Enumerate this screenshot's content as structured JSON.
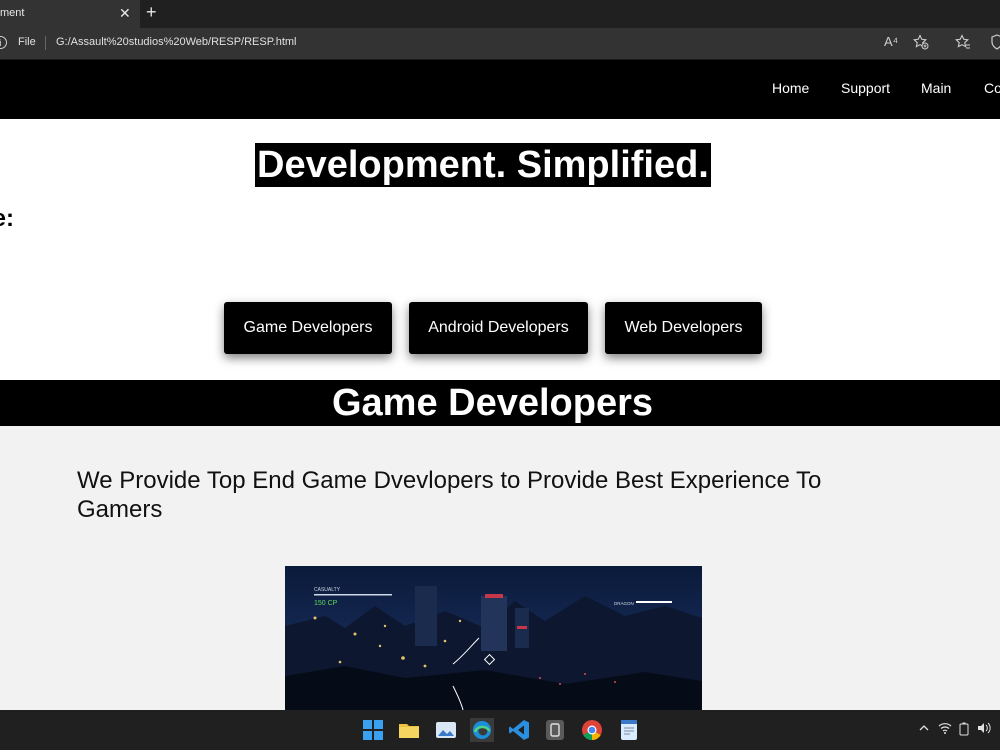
{
  "browser": {
    "tab_title": "ment",
    "file_label": "File",
    "url": "G:/Assault%20studios%20Web/RESP/RESP.html",
    "read_aloud_label": "A⁴"
  },
  "nav": {
    "links": [
      "Home",
      "Support",
      "Main",
      "Co"
    ]
  },
  "hero": {
    "title": "Development. Simplified.",
    "subtitle": "vide:"
  },
  "categories": [
    "Game Developers",
    "Android Developers",
    "Web Developers"
  ],
  "section": {
    "title": "Game Developers",
    "description": "We Provide Top End Game Dvevlopers to Provide Best Experience To Gamers"
  },
  "game_image": {
    "hud_label": "CASUALTY",
    "hud_value": "150 CP",
    "target_label": "DRAGON"
  },
  "colors": {
    "page_black": "#000000",
    "section_bg": "#f2f2f2",
    "taskbar": "#202020",
    "hud_green": "#5fd35f"
  },
  "icons": [
    "info-icon",
    "read-aloud-icon",
    "favorite-add-icon",
    "favorites-icon",
    "shield-icon",
    "windows-start-icon",
    "file-explorer-icon",
    "photos-icon",
    "edge-icon",
    "vscode-icon",
    "terminal-icon",
    "chrome-icon",
    "notepad-icon",
    "chevron-up-icon",
    "wifi-icon",
    "battery-icon",
    "volume-icon"
  ]
}
